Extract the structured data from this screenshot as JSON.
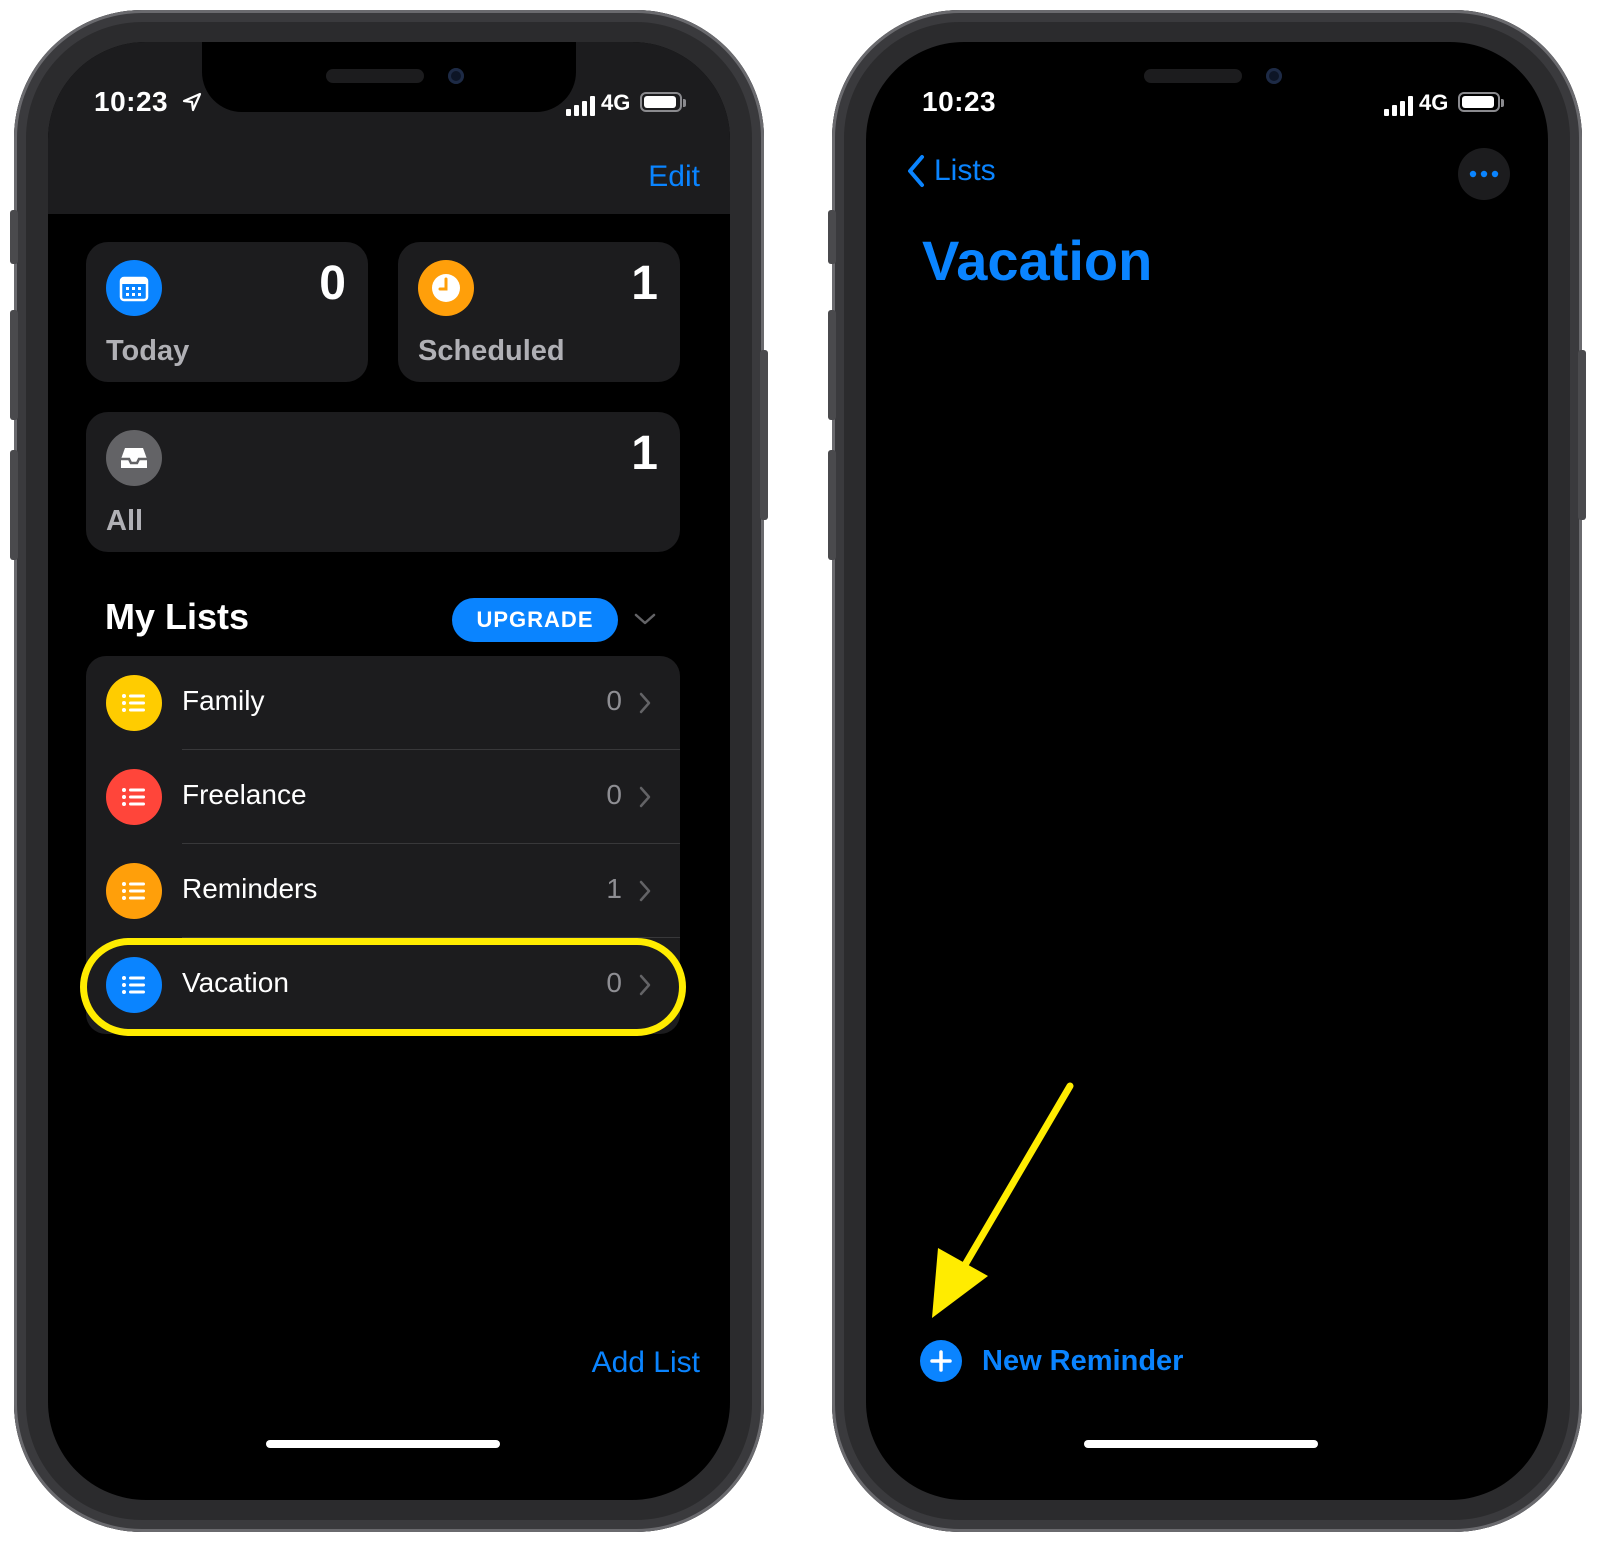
{
  "left_screen": {
    "status": {
      "time": "10:23",
      "network": "4G"
    },
    "nav": {
      "edit_label": "Edit"
    },
    "smart_lists": [
      {
        "label": "Today",
        "count": "0",
        "color": "#0a84ff",
        "icon": "calendar-icon"
      },
      {
        "label": "Scheduled",
        "count": "1",
        "color": "#ff9f0a",
        "icon": "clock-icon"
      },
      {
        "label": "All",
        "count": "1",
        "color": "#8e8e93",
        "icon": "tray-icon"
      }
    ],
    "my_lists": {
      "title": "My Lists",
      "upgrade_label": "UPGRADE",
      "items": [
        {
          "label": "Family",
          "count": "0",
          "color": "#ffcc00"
        },
        {
          "label": "Freelance",
          "count": "0",
          "color": "#ff453a"
        },
        {
          "label": "Reminders",
          "count": "1",
          "color": "#ff9f0a"
        },
        {
          "label": "Vacation",
          "count": "0",
          "color": "#0a84ff"
        }
      ]
    },
    "add_list_label": "Add List",
    "highlight_color": "#ffec00"
  },
  "right_screen": {
    "status": {
      "time": "10:23",
      "network": "4G"
    },
    "back_label": "Lists",
    "title": "Vacation",
    "new_reminder_label": "New Reminder",
    "arrow_color": "#ffec00"
  }
}
